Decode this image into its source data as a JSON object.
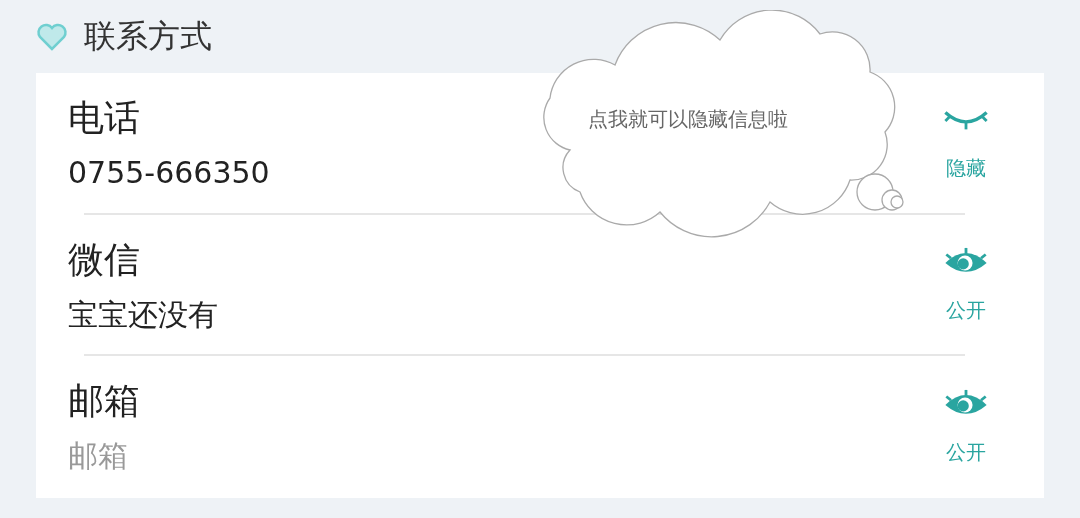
{
  "section": {
    "title": "联系方式"
  },
  "contacts": [
    {
      "label": "电话",
      "value": "0755-666350",
      "visible": false,
      "toggle_label": "隐藏"
    },
    {
      "label": "微信",
      "value": "宝宝还没有",
      "visible": true,
      "toggle_label": "公开"
    },
    {
      "label": "邮箱",
      "placeholder": "邮箱",
      "visible": true,
      "toggle_label": "公开"
    }
  ],
  "tooltip": {
    "text": "点我就可以隐藏信息啦"
  }
}
